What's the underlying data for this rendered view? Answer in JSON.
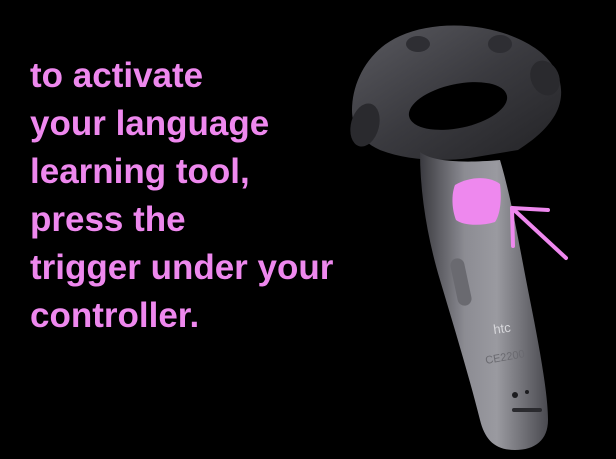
{
  "instruction": {
    "lines": [
      "to activate",
      "your language",
      "learning tool,",
      "press the",
      "trigger under your",
      "controller."
    ],
    "color": "#ee88ee"
  },
  "controller": {
    "brand_label": "htc",
    "cert_label": "CE2200",
    "highlight_color": "#ee88ee",
    "icon": "vr-controller-icon",
    "arrow_icon": "hand-drawn-arrow-icon"
  },
  "colors": {
    "background": "#000000"
  }
}
